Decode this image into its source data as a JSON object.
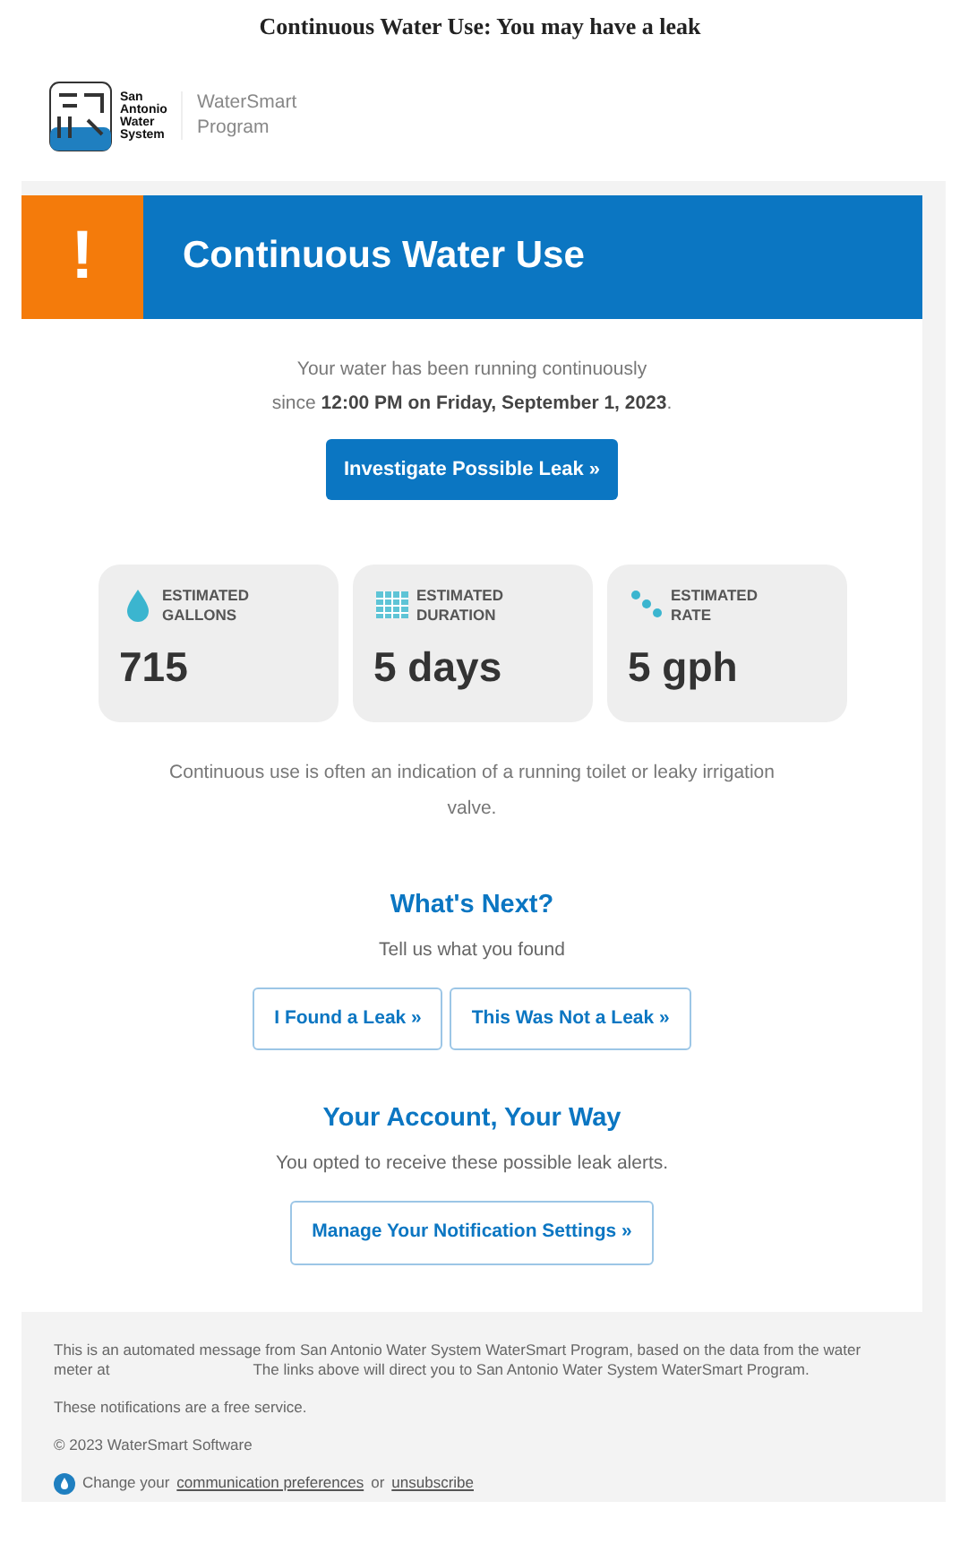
{
  "email_subject": "Continuous Water Use: You may have a leak",
  "logo": {
    "org": "San Antonio Water System",
    "program": "WaterSmart Program"
  },
  "banner": {
    "symbol": "!",
    "title": "Continuous Water Use"
  },
  "intro": {
    "line_1": "Your water has been running continuously",
    "line_2": "since **12:00 PM on Friday, September 1, 2023**."
  },
  "primary_button": "Investigate Possible Leak »",
  "stats": [
    {
      "kind": "drop",
      "label": "ESTIMATED GALLONS",
      "value": "715"
    },
    {
      "kind": "calendar",
      "label": "ESTIMATED DURATION",
      "value": "5 days"
    },
    {
      "kind": "drops",
      "label": "ESTIMATED RATE",
      "value": "5 gph"
    }
  ],
  "note": "Continuous use is often an indication of a running toilet or leaky irrigation valve.",
  "whats_next": {
    "heading": "What's Next?",
    "subtitle": "Tell us what you found",
    "buttons": [
      "I Found a Leak »",
      "This Was Not a Leak »"
    ]
  },
  "account": {
    "heading": "Your Account, Your Way",
    "subtitle": "You opted to receive these possible leak alerts.",
    "button": "Manage Your Notification Settings »"
  },
  "footer": {
    "notice_start": "This is an automated message from San Antonio Water System WaterSmart Program, based on the data from the water meter at",
    "notice_end": "The links above will direct you to San Antonio Water System WaterSmart Program.",
    "free": "These notifications are a free service.",
    "copyright": "© 2023 WaterSmart Software",
    "prefs_before": "Change your",
    "prefs_link": "communication preferences",
    "prefs_middle": "or",
    "unsubscribe": "unsubscribe"
  }
}
